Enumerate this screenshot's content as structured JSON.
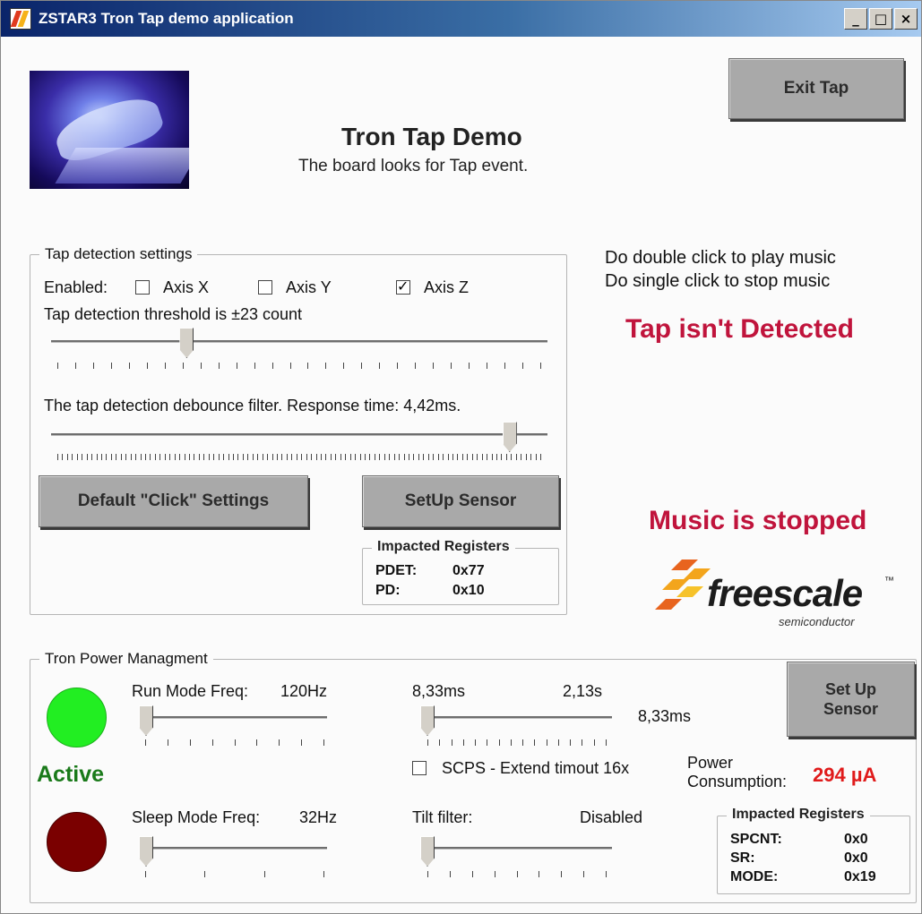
{
  "window": {
    "title": "ZSTAR3 Tron Tap demo application",
    "min": "_",
    "max": "□",
    "close": "×"
  },
  "header": {
    "title": "Tron Tap Demo",
    "subtitle": "The board looks for Tap event.",
    "exit_label": "Exit Tap"
  },
  "hints": {
    "line1": "Do double click to play music",
    "line2": "Do single click to stop music"
  },
  "status": {
    "tap": "Tap isn't Detected",
    "music": "Music is stopped",
    "color": "#c0143c"
  },
  "tap_settings": {
    "legend": "Tap detection settings",
    "enabled_label": "Enabled:",
    "axes": [
      {
        "label": "Axis X",
        "checked": false
      },
      {
        "label": "Axis Y",
        "checked": false
      },
      {
        "label": "Axis Z",
        "checked": true
      }
    ],
    "threshold_label": "Tap detection threshold is ±23 count",
    "threshold_position": 0.27,
    "debounce_label": "The tap detection debounce filter. Response time: 4,42ms.",
    "debounce_position": 0.93,
    "default_button": "Default \"Click\" Settings",
    "setup_button": "SetUp Sensor",
    "registers": {
      "legend": "Impacted Registers",
      "rows": [
        {
          "name": "PDET:",
          "value": "0x77"
        },
        {
          "name": "PD:",
          "value": "0x10"
        }
      ]
    }
  },
  "logo": {
    "brand": "freescale",
    "tm": "™",
    "sub": "semiconductor"
  },
  "power": {
    "legend": "Tron Power Managment",
    "active_label": "Active",
    "active_color": "#22ee22",
    "sleep_color": "#7a0000",
    "run_mode": {
      "label": "Run Mode Freq:",
      "value": "120Hz",
      "position": 0.0
    },
    "sleep_mode": {
      "label": "Sleep Mode Freq:",
      "value": "32Hz",
      "position": 0.0
    },
    "timeout": {
      "min": "8,33ms",
      "max": "2,13s",
      "current": "8,33ms",
      "position": 0.0
    },
    "scps": {
      "label": "SCPS - Extend timout 16x",
      "checked": false
    },
    "tilt": {
      "label": "Tilt filter:",
      "value": "Disabled",
      "position": 0.0
    },
    "consumption": {
      "label1": "Power",
      "label2": "Consumption:",
      "value": "294 µA",
      "color": "#e01b1b"
    },
    "setup_button": {
      "line1": "Set Up",
      "line2": "Sensor"
    },
    "registers": {
      "legend": "Impacted Registers",
      "rows": [
        {
          "name": "SPCNT:",
          "value": "0x0"
        },
        {
          "name": "SR:",
          "value": "0x0"
        },
        {
          "name": "MODE:",
          "value": "0x19"
        }
      ]
    }
  }
}
